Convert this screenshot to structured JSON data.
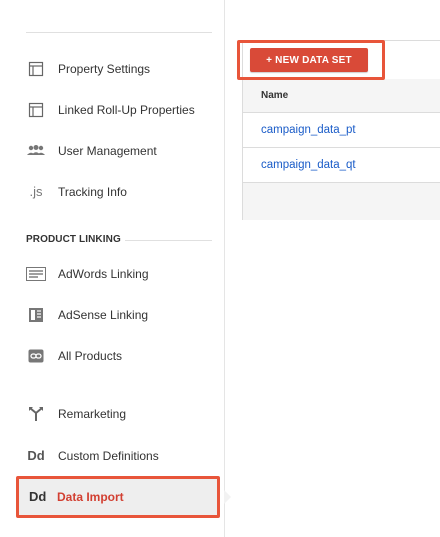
{
  "sidebar": {
    "items": [
      {
        "label": "Property Settings",
        "icon": "property-settings-icon"
      },
      {
        "label": "Linked Roll-Up Properties",
        "icon": "linked-rollup-icon"
      },
      {
        "label": "User Management",
        "icon": "users-icon"
      },
      {
        "label": "Tracking Info",
        "icon": "js-icon",
        "icon_text": ".js"
      }
    ],
    "section_header": "PRODUCT LINKING",
    "linking_items": [
      {
        "label": "AdWords Linking",
        "icon": "adwords-icon"
      },
      {
        "label": "AdSense Linking",
        "icon": "adsense-icon"
      },
      {
        "label": "All Products",
        "icon": "link-icon"
      }
    ],
    "bottom_items": [
      {
        "label": "Remarketing",
        "icon": "remarketing-icon"
      },
      {
        "label": "Custom Definitions",
        "icon": "dd-icon",
        "icon_text": "Dd"
      },
      {
        "label": "Data Import",
        "icon": "dd-icon",
        "icon_text": "Dd",
        "active": true
      }
    ]
  },
  "main": {
    "new_button_label": "+ NEW DATA SET",
    "table": {
      "column_header": "Name",
      "rows": [
        "campaign_data_pt",
        "campaign_data_qt"
      ]
    }
  },
  "colors": {
    "accent_red": "#d94a38",
    "highlight_border": "#e8553a",
    "link_blue": "#1a5cc8",
    "active_label": "#d23f31"
  }
}
